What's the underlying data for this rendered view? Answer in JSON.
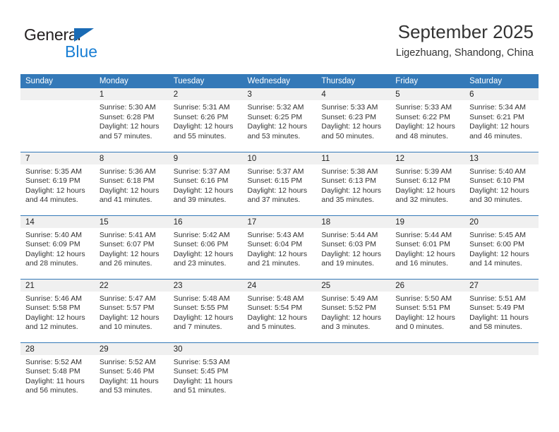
{
  "brand": {
    "name_top": "General",
    "name_bottom": "Blue"
  },
  "header": {
    "title": "September 2025",
    "location": "Ligezhuang, Shandong, China"
  },
  "colors": {
    "header_blue": "#3479b8",
    "brand_blue": "#1a7fd4",
    "daynum_band": "#f0f0f0",
    "text": "#333333"
  },
  "weekday_headers": [
    "Sunday",
    "Monday",
    "Tuesday",
    "Wednesday",
    "Thursday",
    "Friday",
    "Saturday"
  ],
  "weeks": [
    [
      {
        "day": "",
        "sunrise": "",
        "sunset": "",
        "daylight1": "",
        "daylight2": "",
        "blank": true
      },
      {
        "day": "1",
        "sunrise": "Sunrise: 5:30 AM",
        "sunset": "Sunset: 6:28 PM",
        "daylight1": "Daylight: 12 hours",
        "daylight2": "and 57 minutes."
      },
      {
        "day": "2",
        "sunrise": "Sunrise: 5:31 AM",
        "sunset": "Sunset: 6:26 PM",
        "daylight1": "Daylight: 12 hours",
        "daylight2": "and 55 minutes."
      },
      {
        "day": "3",
        "sunrise": "Sunrise: 5:32 AM",
        "sunset": "Sunset: 6:25 PM",
        "daylight1": "Daylight: 12 hours",
        "daylight2": "and 53 minutes."
      },
      {
        "day": "4",
        "sunrise": "Sunrise: 5:33 AM",
        "sunset": "Sunset: 6:23 PM",
        "daylight1": "Daylight: 12 hours",
        "daylight2": "and 50 minutes."
      },
      {
        "day": "5",
        "sunrise": "Sunrise: 5:33 AM",
        "sunset": "Sunset: 6:22 PM",
        "daylight1": "Daylight: 12 hours",
        "daylight2": "and 48 minutes."
      },
      {
        "day": "6",
        "sunrise": "Sunrise: 5:34 AM",
        "sunset": "Sunset: 6:21 PM",
        "daylight1": "Daylight: 12 hours",
        "daylight2": "and 46 minutes."
      }
    ],
    [
      {
        "day": "7",
        "sunrise": "Sunrise: 5:35 AM",
        "sunset": "Sunset: 6:19 PM",
        "daylight1": "Daylight: 12 hours",
        "daylight2": "and 44 minutes."
      },
      {
        "day": "8",
        "sunrise": "Sunrise: 5:36 AM",
        "sunset": "Sunset: 6:18 PM",
        "daylight1": "Daylight: 12 hours",
        "daylight2": "and 41 minutes."
      },
      {
        "day": "9",
        "sunrise": "Sunrise: 5:37 AM",
        "sunset": "Sunset: 6:16 PM",
        "daylight1": "Daylight: 12 hours",
        "daylight2": "and 39 minutes."
      },
      {
        "day": "10",
        "sunrise": "Sunrise: 5:37 AM",
        "sunset": "Sunset: 6:15 PM",
        "daylight1": "Daylight: 12 hours",
        "daylight2": "and 37 minutes."
      },
      {
        "day": "11",
        "sunrise": "Sunrise: 5:38 AM",
        "sunset": "Sunset: 6:13 PM",
        "daylight1": "Daylight: 12 hours",
        "daylight2": "and 35 minutes."
      },
      {
        "day": "12",
        "sunrise": "Sunrise: 5:39 AM",
        "sunset": "Sunset: 6:12 PM",
        "daylight1": "Daylight: 12 hours",
        "daylight2": "and 32 minutes."
      },
      {
        "day": "13",
        "sunrise": "Sunrise: 5:40 AM",
        "sunset": "Sunset: 6:10 PM",
        "daylight1": "Daylight: 12 hours",
        "daylight2": "and 30 minutes."
      }
    ],
    [
      {
        "day": "14",
        "sunrise": "Sunrise: 5:40 AM",
        "sunset": "Sunset: 6:09 PM",
        "daylight1": "Daylight: 12 hours",
        "daylight2": "and 28 minutes."
      },
      {
        "day": "15",
        "sunrise": "Sunrise: 5:41 AM",
        "sunset": "Sunset: 6:07 PM",
        "daylight1": "Daylight: 12 hours",
        "daylight2": "and 26 minutes."
      },
      {
        "day": "16",
        "sunrise": "Sunrise: 5:42 AM",
        "sunset": "Sunset: 6:06 PM",
        "daylight1": "Daylight: 12 hours",
        "daylight2": "and 23 minutes."
      },
      {
        "day": "17",
        "sunrise": "Sunrise: 5:43 AM",
        "sunset": "Sunset: 6:04 PM",
        "daylight1": "Daylight: 12 hours",
        "daylight2": "and 21 minutes."
      },
      {
        "day": "18",
        "sunrise": "Sunrise: 5:44 AM",
        "sunset": "Sunset: 6:03 PM",
        "daylight1": "Daylight: 12 hours",
        "daylight2": "and 19 minutes."
      },
      {
        "day": "19",
        "sunrise": "Sunrise: 5:44 AM",
        "sunset": "Sunset: 6:01 PM",
        "daylight1": "Daylight: 12 hours",
        "daylight2": "and 16 minutes."
      },
      {
        "day": "20",
        "sunrise": "Sunrise: 5:45 AM",
        "sunset": "Sunset: 6:00 PM",
        "daylight1": "Daylight: 12 hours",
        "daylight2": "and 14 minutes."
      }
    ],
    [
      {
        "day": "21",
        "sunrise": "Sunrise: 5:46 AM",
        "sunset": "Sunset: 5:58 PM",
        "daylight1": "Daylight: 12 hours",
        "daylight2": "and 12 minutes."
      },
      {
        "day": "22",
        "sunrise": "Sunrise: 5:47 AM",
        "sunset": "Sunset: 5:57 PM",
        "daylight1": "Daylight: 12 hours",
        "daylight2": "and 10 minutes."
      },
      {
        "day": "23",
        "sunrise": "Sunrise: 5:48 AM",
        "sunset": "Sunset: 5:55 PM",
        "daylight1": "Daylight: 12 hours",
        "daylight2": "and 7 minutes."
      },
      {
        "day": "24",
        "sunrise": "Sunrise: 5:48 AM",
        "sunset": "Sunset: 5:54 PM",
        "daylight1": "Daylight: 12 hours",
        "daylight2": "and 5 minutes."
      },
      {
        "day": "25",
        "sunrise": "Sunrise: 5:49 AM",
        "sunset": "Sunset: 5:52 PM",
        "daylight1": "Daylight: 12 hours",
        "daylight2": "and 3 minutes."
      },
      {
        "day": "26",
        "sunrise": "Sunrise: 5:50 AM",
        "sunset": "Sunset: 5:51 PM",
        "daylight1": "Daylight: 12 hours",
        "daylight2": "and 0 minutes."
      },
      {
        "day": "27",
        "sunrise": "Sunrise: 5:51 AM",
        "sunset": "Sunset: 5:49 PM",
        "daylight1": "Daylight: 11 hours",
        "daylight2": "and 58 minutes."
      }
    ],
    [
      {
        "day": "28",
        "sunrise": "Sunrise: 5:52 AM",
        "sunset": "Sunset: 5:48 PM",
        "daylight1": "Daylight: 11 hours",
        "daylight2": "and 56 minutes."
      },
      {
        "day": "29",
        "sunrise": "Sunrise: 5:52 AM",
        "sunset": "Sunset: 5:46 PM",
        "daylight1": "Daylight: 11 hours",
        "daylight2": "and 53 minutes."
      },
      {
        "day": "30",
        "sunrise": "Sunrise: 5:53 AM",
        "sunset": "Sunset: 5:45 PM",
        "daylight1": "Daylight: 11 hours",
        "daylight2": "and 51 minutes."
      },
      {
        "day": "",
        "sunrise": "",
        "sunset": "",
        "daylight1": "",
        "daylight2": "",
        "blank": true
      },
      {
        "day": "",
        "sunrise": "",
        "sunset": "",
        "daylight1": "",
        "daylight2": "",
        "blank": true
      },
      {
        "day": "",
        "sunrise": "",
        "sunset": "",
        "daylight1": "",
        "daylight2": "",
        "blank": true
      },
      {
        "day": "",
        "sunrise": "",
        "sunset": "",
        "daylight1": "",
        "daylight2": "",
        "blank": true
      }
    ]
  ]
}
